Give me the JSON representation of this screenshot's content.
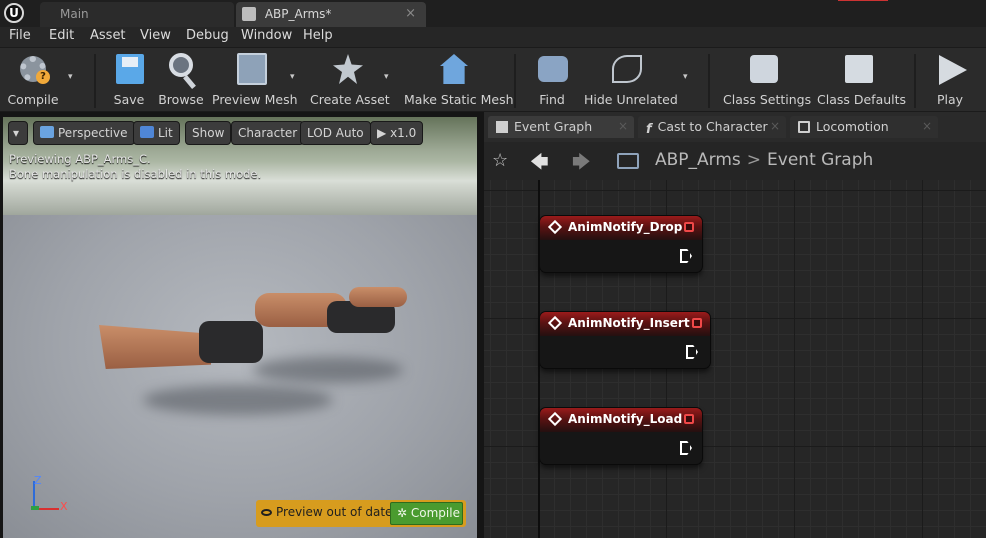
{
  "titlebar": {
    "logo": "U",
    "tabs": [
      {
        "label": "Main"
      },
      {
        "label": "ABP_Arms*",
        "close": "×"
      }
    ]
  },
  "menu": [
    "File",
    "Edit",
    "Asset",
    "View",
    "Debug",
    "Window",
    "Help"
  ],
  "toolbar": {
    "compile": "Compile",
    "save": "Save",
    "browse": "Browse",
    "preview_mesh": "Preview Mesh",
    "create_asset": "Create Asset",
    "make_static_mesh": "Make Static Mesh",
    "find": "Find",
    "hide_unrelated": "Hide Unrelated",
    "class_settings": "Class Settings",
    "class_defaults": "Class Defaults",
    "play": "Play",
    "caret": "▾"
  },
  "viewport": {
    "menu_caret": "▾",
    "perspective": "Perspective",
    "lit": "Lit",
    "show": "Show",
    "character": "Character",
    "lod": "LOD Auto",
    "speed": "x1.0",
    "info_line1": "Previewing ABP_Arms_C.",
    "info_line2": "Bone manipulation is disabled in this mode.",
    "axis_z": "Z",
    "axis_x": "X",
    "preview_out_of_date": "Preview out of date",
    "compile_button": "Compile"
  },
  "graph_tabs": [
    {
      "label": "Event Graph",
      "icon": "event-graph-icon",
      "close": "×"
    },
    {
      "label": "Cast to Character",
      "icon": "function-icon",
      "close": "×"
    },
    {
      "label": "Locomotion",
      "icon": "state-machine-icon",
      "close": "×"
    }
  ],
  "breadcrumb": {
    "root": "ABP_Arms",
    "separator": ">",
    "current": "Event Graph",
    "star": "☆",
    "back": "🡄",
    "forward": "🡆"
  },
  "nodes": [
    {
      "title": "AnimNotify_Drop"
    },
    {
      "title": "AnimNotify_Insert"
    },
    {
      "title": "AnimNotify_Load"
    }
  ],
  "colors": {
    "node_header": "#9b1b1b",
    "preview_bar": "#d79c1e",
    "compile_green": "#4a9b2f",
    "accent_blue": "#2e6cd8"
  }
}
